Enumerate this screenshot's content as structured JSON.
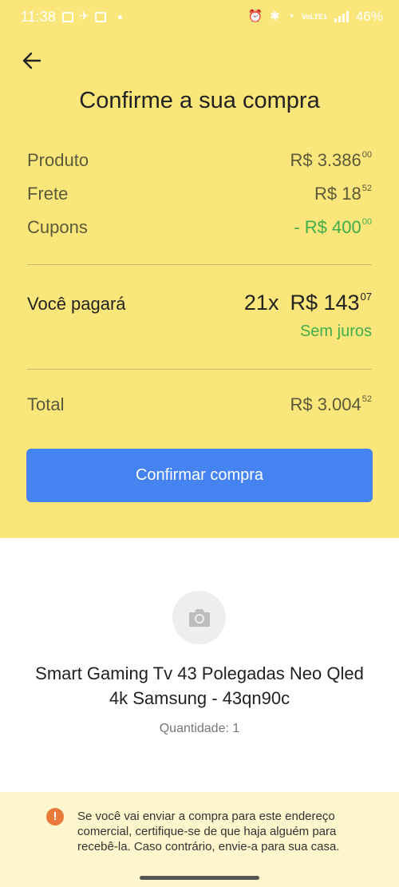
{
  "status_bar": {
    "time": "11:38",
    "network": "VoLTE1",
    "battery": "46%"
  },
  "header": {
    "title": "Confirme a sua compra"
  },
  "summary": {
    "produto_label": "Produto",
    "produto_value": "R$ 3.386",
    "produto_cents": "00",
    "frete_label": "Frete",
    "frete_value": "R$ 18",
    "frete_cents": "52",
    "cupons_label": "Cupons",
    "cupons_value": "- R$ 400",
    "cupons_cents": "00"
  },
  "payment": {
    "label": "Você pagará",
    "installments": "21x",
    "value": "R$ 143",
    "cents": "07",
    "interest": "Sem juros"
  },
  "total": {
    "label": "Total",
    "value": "R$ 3.004",
    "cents": "52"
  },
  "actions": {
    "confirm_label": "Confirmar compra"
  },
  "product": {
    "name": "Smart Gaming Tv 43 Polegadas Neo Qled 4k Samsung - 43qn90c",
    "quantity": "Quantidade: 1"
  },
  "notice": {
    "text": "Se você vai enviar a compra para este endereço comercial, certifique-se de que haja alguém para recebê-la. Caso contrário, envie-a para sua casa."
  },
  "colors": {
    "header_bg": "#fbe67b",
    "accent_blue": "#4583f1",
    "success_green": "#3fae4a",
    "notice_bg": "#fef6cc",
    "warning_orange": "#e97a3a"
  }
}
